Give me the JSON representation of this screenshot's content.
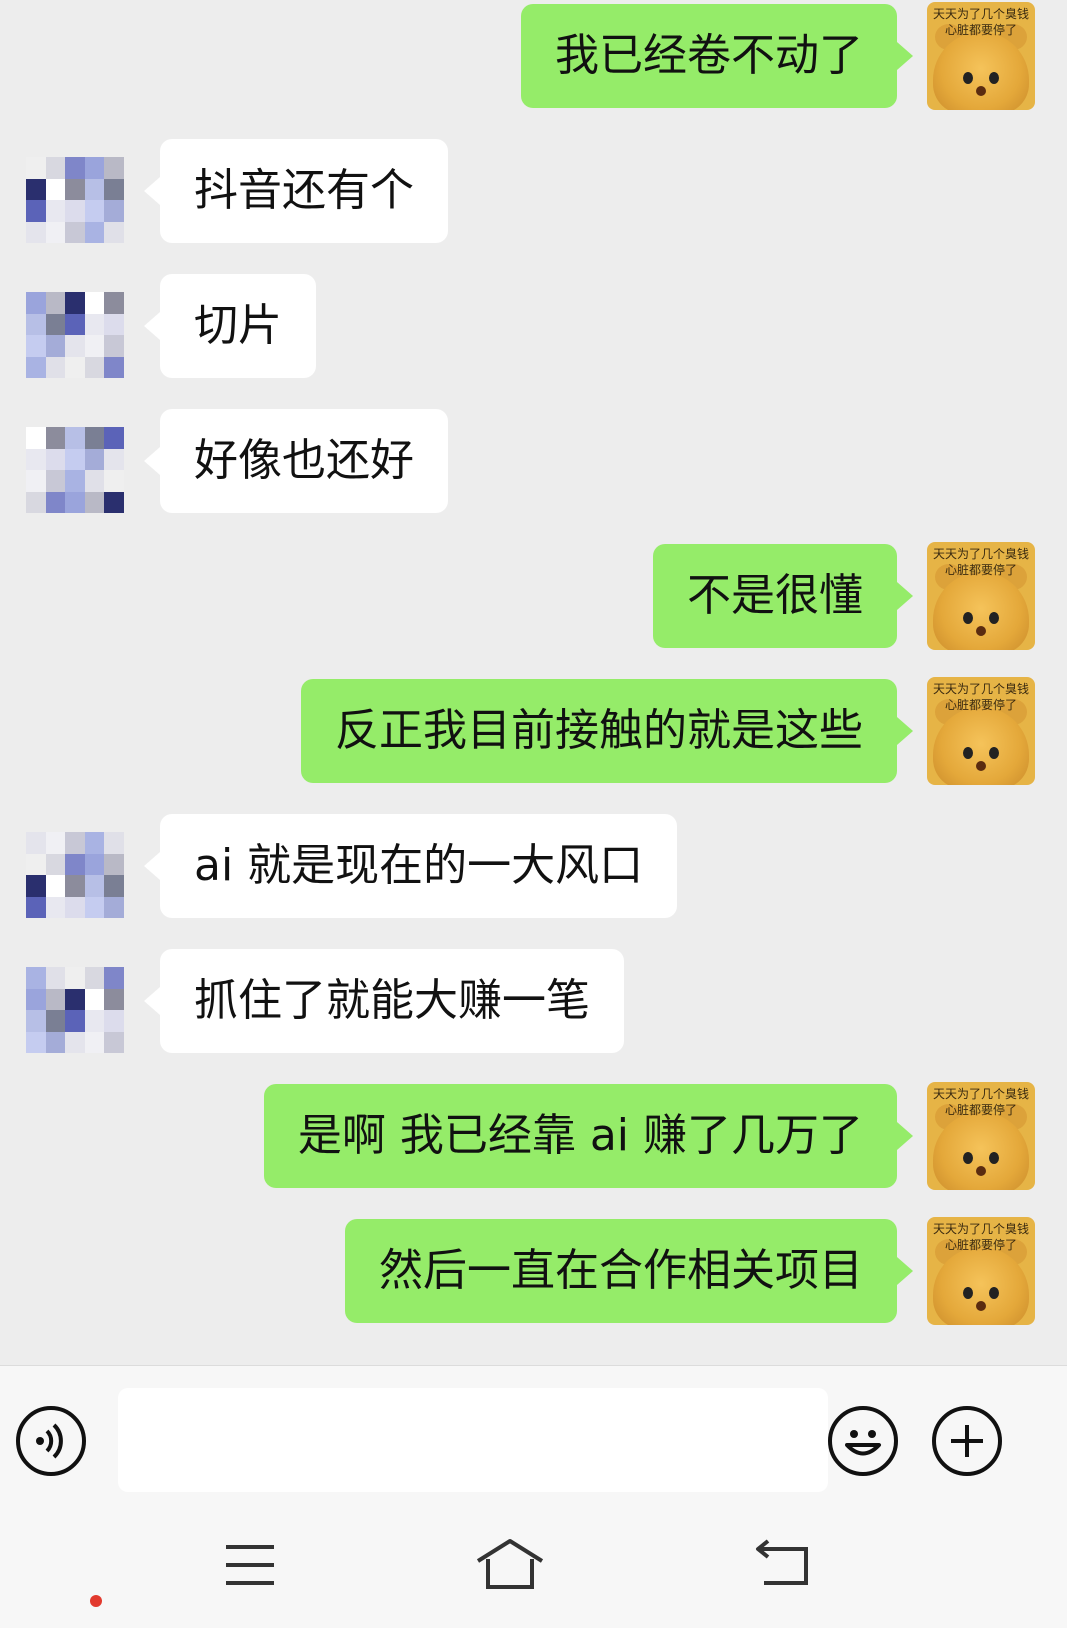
{
  "messages": [
    {
      "side": "me",
      "text": "我已经卷不动了"
    },
    {
      "side": "other",
      "text": "抖音还有个"
    },
    {
      "side": "other",
      "text": "切片"
    },
    {
      "side": "other",
      "text": "好像也还好"
    },
    {
      "side": "me",
      "text": "不是很懂"
    },
    {
      "side": "me",
      "text": "反正我目前接触的就是这些"
    },
    {
      "side": "other",
      "text": "ai 就是现在的一大风口"
    },
    {
      "side": "other",
      "text": "抓住了就能大赚一笔"
    },
    {
      "side": "me",
      "text": "是啊  我已经靠 ai 赚了几万了"
    },
    {
      "side": "me",
      "text": "然后一直在合作相关项目"
    }
  ],
  "my_avatar": {
    "caption": "天天为了几个臭钱 心脏都要停了",
    "icon": "crying-bear-sticker"
  },
  "other_avatar": {
    "icon": "pixelated-avatar"
  },
  "input_bar": {
    "value": "",
    "voice_icon": "voice-icon",
    "emoji_icon": "emoji-icon",
    "plus_icon": "plus-icon"
  },
  "nav_bar": {
    "menu_icon": "menu-icon",
    "home_icon": "home-icon",
    "back_icon": "back-icon"
  },
  "colors": {
    "sent_bubble": "#95ec69",
    "received_bubble": "#ffffff",
    "background": "#ededed",
    "notification_dot": "#e23a2e"
  }
}
